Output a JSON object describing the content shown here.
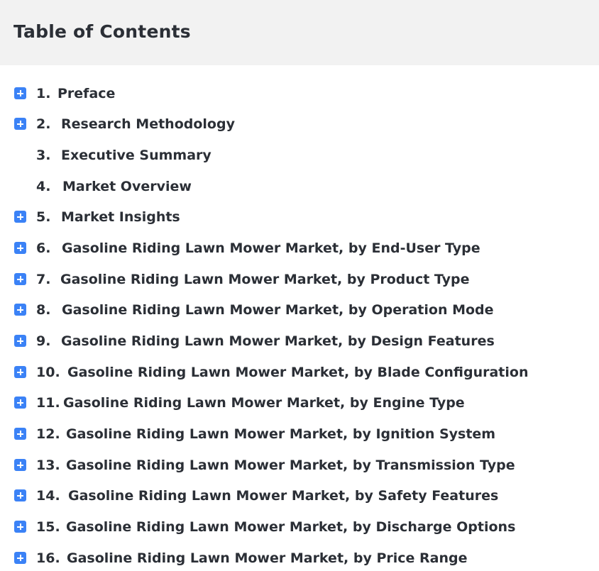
{
  "header": {
    "title": "Table of Contents"
  },
  "toc": {
    "items": [
      {
        "number": "1.",
        "label": "Preface",
        "expandable": true
      },
      {
        "number": "2.",
        "label": "Research Methodology",
        "expandable": true
      },
      {
        "number": "3.",
        "label": "Executive Summary",
        "expandable": false
      },
      {
        "number": "4.",
        "label": "Market Overview",
        "expandable": false
      },
      {
        "number": "5.",
        "label": "Market Insights",
        "expandable": true
      },
      {
        "number": "6.",
        "label": "Gasoline Riding Lawn Mower Market, by End-User Type",
        "expandable": true
      },
      {
        "number": "7.",
        "label": "Gasoline Riding Lawn Mower Market, by Product Type",
        "expandable": true
      },
      {
        "number": "8.",
        "label": "Gasoline Riding Lawn Mower Market, by Operation Mode",
        "expandable": true
      },
      {
        "number": "9.",
        "label": "Gasoline Riding Lawn Mower Market, by Design Features",
        "expandable": true
      },
      {
        "number": "10.",
        "label": "Gasoline Riding Lawn Mower Market, by Blade Configuration",
        "expandable": true
      },
      {
        "number": "11.",
        "label": "Gasoline Riding Lawn Mower Market, by Engine Type",
        "expandable": true
      },
      {
        "number": "12.",
        "label": "Gasoline Riding Lawn Mower Market, by Ignition System",
        "expandable": true
      },
      {
        "number": "13.",
        "label": "Gasoline Riding Lawn Mower Market, by Transmission Type",
        "expandable": true
      },
      {
        "number": "14.",
        "label": "Gasoline Riding Lawn Mower Market, by Safety Features",
        "expandable": true
      },
      {
        "number": "15.",
        "label": "Gasoline Riding Lawn Mower Market, by Discharge Options",
        "expandable": true
      },
      {
        "number": "16.",
        "label": "Gasoline Riding Lawn Mower Market, by Price Range",
        "expandable": true
      }
    ],
    "expand_icon": "plus-square-icon",
    "accent_color": "#3b82f6"
  }
}
